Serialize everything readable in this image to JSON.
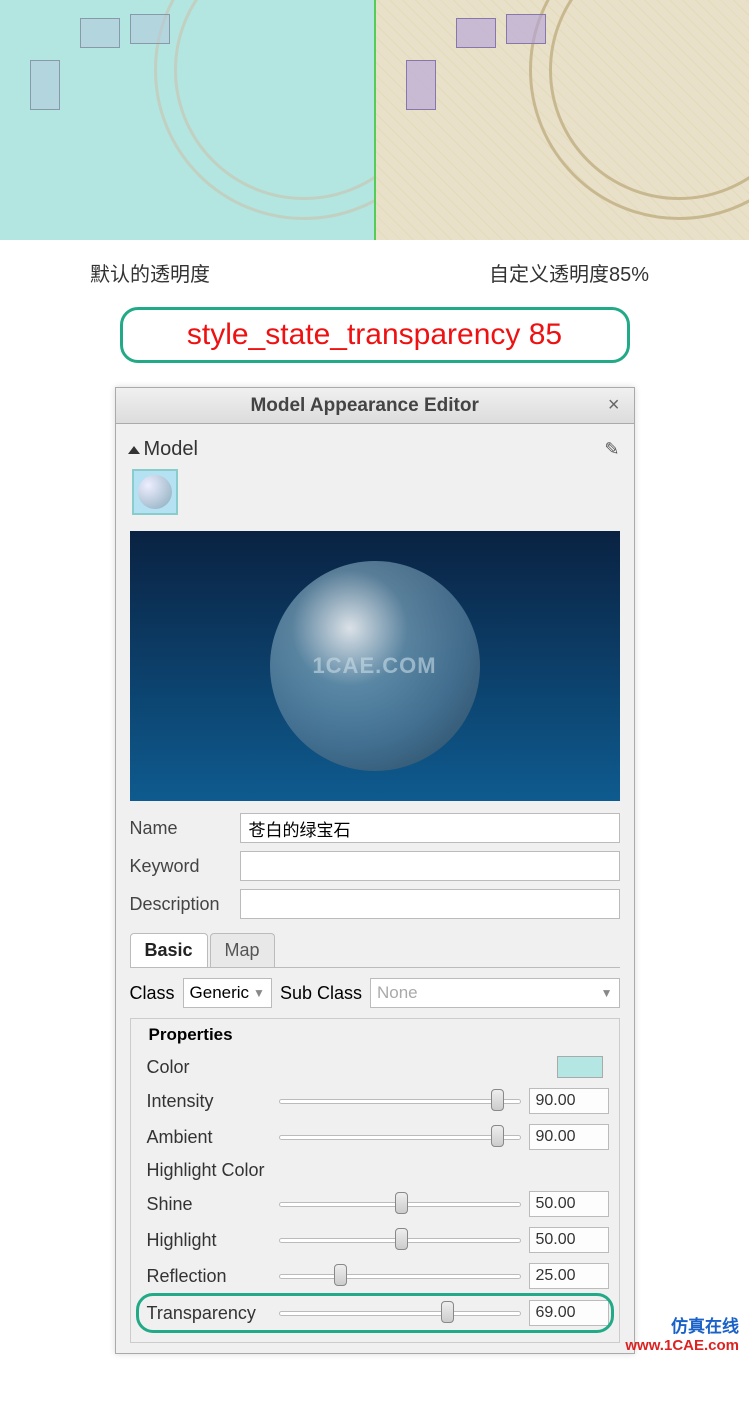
{
  "labels": {
    "default": "默认的透明度",
    "custom": "自定义透明度85%"
  },
  "code_line": "style_state_transparency 85",
  "editor": {
    "title": "Model Appearance Editor",
    "model_section": "Model",
    "eyedropper_icon": "eyedropper-icon",
    "sphere_watermark": "1CAE.COM",
    "fields": {
      "name_label": "Name",
      "name_value": "苍白的绿宝石",
      "keyword_label": "Keyword",
      "keyword_value": "",
      "description_label": "Description",
      "description_value": ""
    },
    "tabs": {
      "basic": "Basic",
      "map": "Map"
    },
    "class_row": {
      "class_label": "Class",
      "class_value": "Generic",
      "subclass_label": "Sub Class",
      "subclass_value": "None"
    },
    "props": {
      "title": "Properties",
      "color_label": "Color",
      "intensity_label": "Intensity",
      "intensity_value": "90.00",
      "ambient_label": "Ambient",
      "ambient_value": "90.00",
      "highlight_color_label": "Highlight Color",
      "shine_label": "Shine",
      "shine_value": "50.00",
      "highlight_label": "Highlight",
      "highlight_value": "50.00",
      "reflection_label": "Reflection",
      "reflection_value": "25.00",
      "transparency_label": "Transparency",
      "transparency_value": "69.00"
    }
  },
  "watermark": {
    "cn": "仿真在线",
    "url": "www.1CAE.com"
  }
}
